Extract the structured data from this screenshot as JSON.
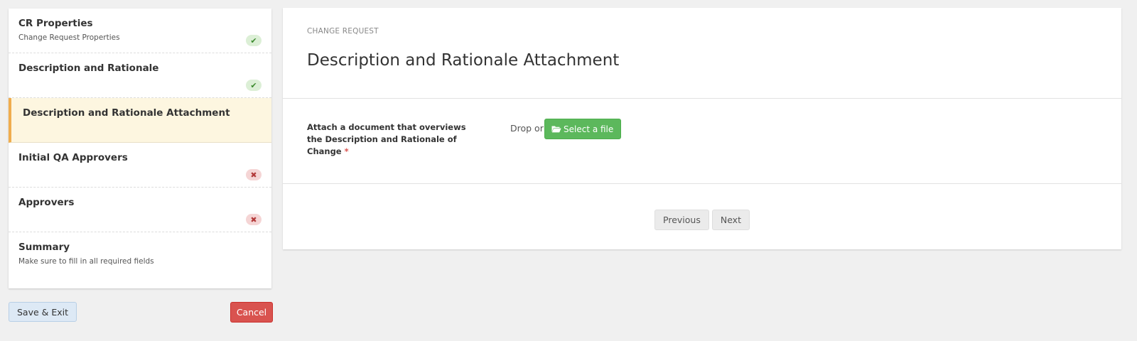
{
  "sidebar": {
    "steps": [
      {
        "title": "CR Properties",
        "subtitle": "Change Request Properties",
        "status": "ok",
        "status_icon": "check-icon"
      },
      {
        "title": "Description and Rationale",
        "subtitle": "",
        "status": "ok",
        "status_icon": "check-icon"
      },
      {
        "title": "Description and Rationale Attachment",
        "subtitle": "",
        "status": "active"
      },
      {
        "title": "Initial QA Approvers",
        "subtitle": "",
        "status": "error",
        "status_icon": "x-icon"
      },
      {
        "title": "Approvers",
        "subtitle": "",
        "status": "error",
        "status_icon": "x-icon"
      },
      {
        "title": "Summary",
        "subtitle": "Make sure to fill in all required fields",
        "status": "none"
      }
    ],
    "save_label": "Save & Exit",
    "cancel_label": "Cancel"
  },
  "main": {
    "eyebrow": "CHANGE REQUEST",
    "title": "Description and Rationale Attachment",
    "field_label": "Attach a document that overviews the Description and Rationale of Change",
    "required_marker": "*",
    "drop_text": "Drop or",
    "select_file_label": "Select a file",
    "previous_label": "Previous",
    "next_label": "Next"
  },
  "colors": {
    "active_bg": "#fdf6e0",
    "active_border": "#f0ad4e",
    "success": "#5cb85c",
    "danger": "#d9534f",
    "ok_badge_bg": "#dcefd6",
    "error_badge_bg": "#f5d5d5"
  }
}
